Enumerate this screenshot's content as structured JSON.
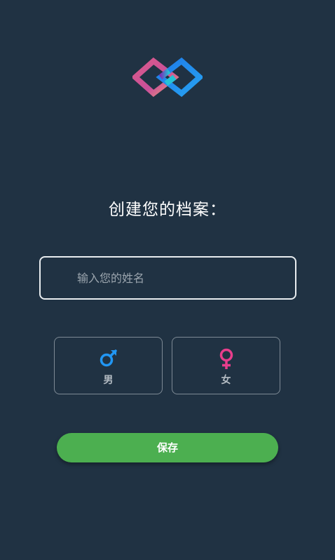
{
  "header": {
    "title": "创建您的档案："
  },
  "form": {
    "name_placeholder": "输入您的姓名",
    "name_value": ""
  },
  "gender": {
    "male_label": "男",
    "female_label": "女",
    "male_icon": "male-icon",
    "female_icon": "female-icon",
    "male_color": "#2196f3",
    "female_color": "#e83e8c"
  },
  "actions": {
    "save_label": "保存",
    "save_color": "#4caf50"
  },
  "theme": {
    "background": "#203243"
  }
}
